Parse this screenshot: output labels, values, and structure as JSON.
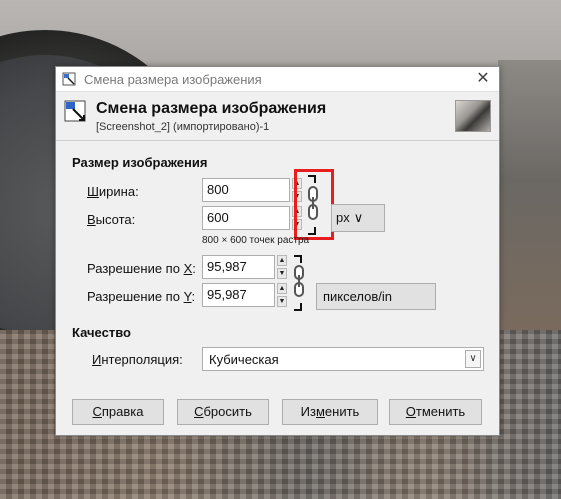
{
  "window": {
    "title": "Смена размера изображения",
    "close_glyph": "✕"
  },
  "header": {
    "title": "Смена размера изображения",
    "subtitle": "[Screenshot_2] (импортировано)-1"
  },
  "size_section": {
    "title": "Размер изображения",
    "width_label_first": "Ш",
    "width_label_rest": "ирина:",
    "width_value": "800",
    "height_label_first": "В",
    "height_label_rest": "ысота:",
    "height_value": "600",
    "pixel_info": "800 × 600 точек растра",
    "unit": "px",
    "unit_chevron": "∨",
    "res_x_label_pre": "Разрешение по ",
    "res_x_label_key": "X",
    "res_x_label_post": ":",
    "res_x_value": "95,987",
    "res_y_label_pre": "Разрешение по ",
    "res_y_label_key": "Y",
    "res_y_label_post": ":",
    "res_y_value": "95,987",
    "res_unit": "пикселов/in",
    "chain_linked": true
  },
  "quality_section": {
    "title": "Качество",
    "interp_label_first": "И",
    "interp_label_rest": "нтерполяция:",
    "interp_value": "Кубическая",
    "interp_chevron": "∨"
  },
  "buttons": {
    "help_key": "С",
    "help_rest": "правка",
    "reset_key": "С",
    "reset_rest": "бросить",
    "apply_pre": "Из",
    "apply_key": "м",
    "apply_post": "енить",
    "cancel_key": "О",
    "cancel_rest": "тменить"
  },
  "colors": {
    "highlight": "#e81e1e",
    "dialog_bg": "#f0f0f0"
  },
  "icons": {
    "title": "gimp-resize-icon",
    "header": "resize-image-icon",
    "chain": "chain-link-icon",
    "spin_up": "▲",
    "spin_down": "▼"
  }
}
